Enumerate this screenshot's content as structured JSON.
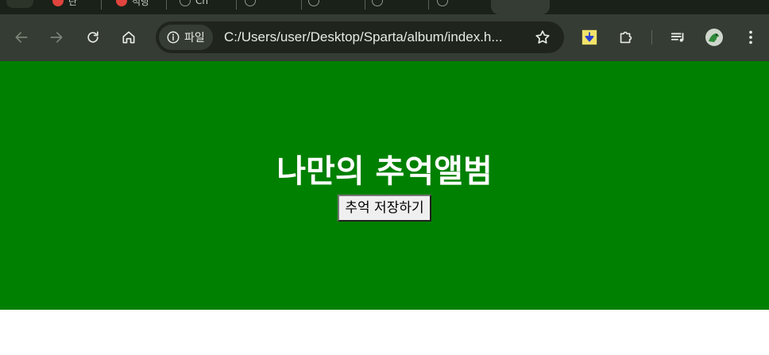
{
  "browser": {
    "tabs": [
      {
        "label": "란",
        "icon": "red-circle-icon"
      },
      {
        "label": "적당",
        "icon": "red-circle-icon"
      },
      {
        "label": "Ch",
        "icon": "globe-icon"
      },
      {
        "label": "",
        "icon": "globe-icon"
      },
      {
        "label": "",
        "icon": "globe-icon"
      },
      {
        "label": "",
        "icon": "globe-icon"
      },
      {
        "label": "",
        "icon": "globe-icon"
      }
    ],
    "site_chip_label": "파일",
    "url": "C:/Users/user/Desktop/Sparta/album/index.h...",
    "colors": {
      "tabstrip": "#1a2118",
      "toolbar": "#353c33",
      "omnibox": "#1f251d",
      "text": "#e6ebe3"
    }
  },
  "page": {
    "title": "나만의 추억앨범",
    "button_label": "추억 저장하기",
    "colors": {
      "hero_background": "#008000",
      "title": "#ffffff",
      "background": "#ffffff"
    }
  }
}
